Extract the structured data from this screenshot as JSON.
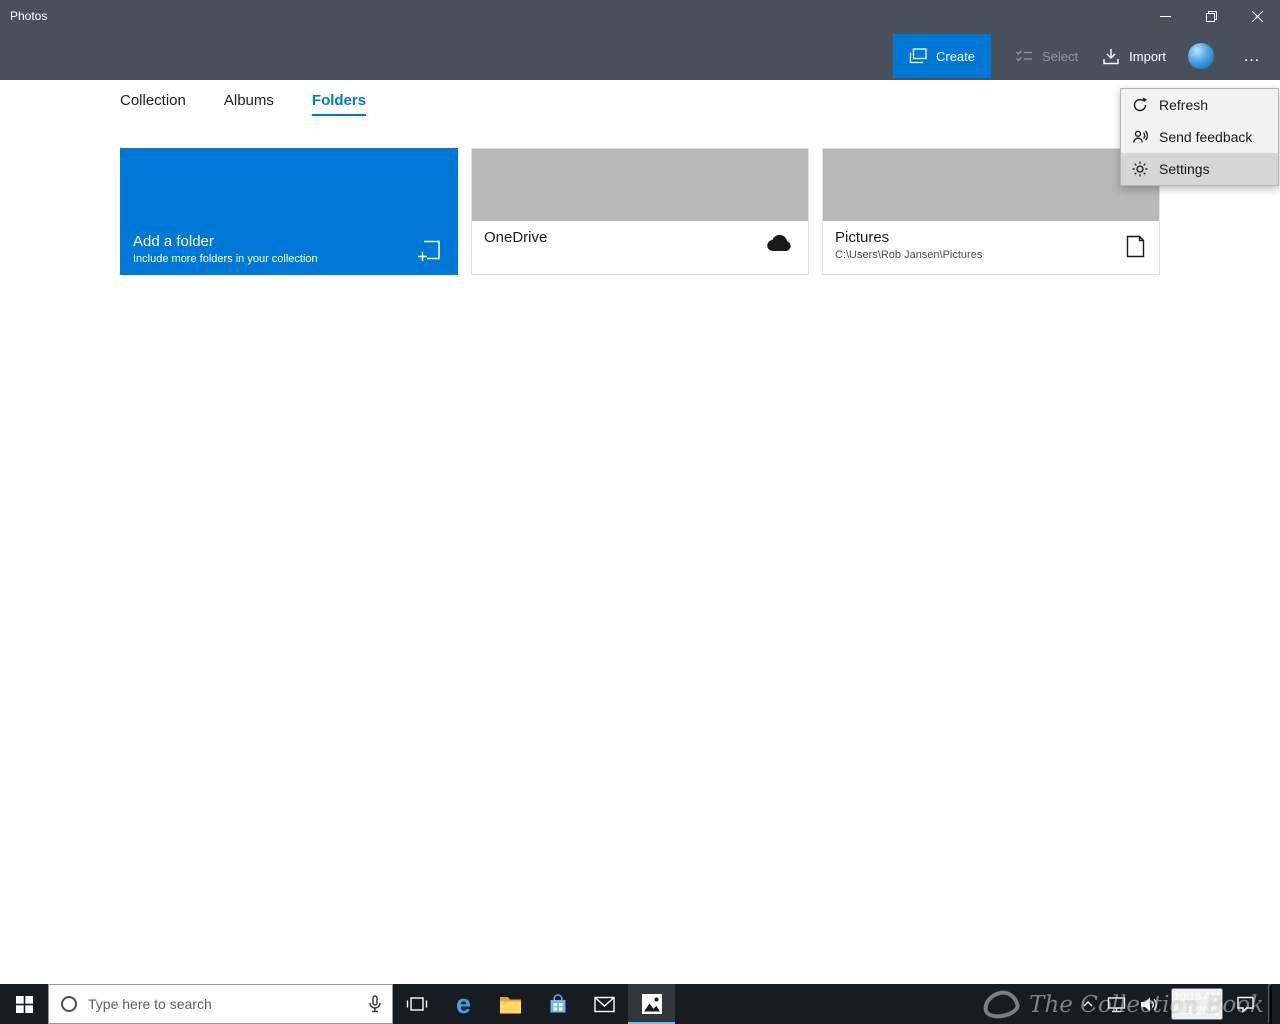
{
  "window": {
    "title": "Photos"
  },
  "toolbar": {
    "create_label": "Create",
    "select_label": "Select",
    "import_label": "Import",
    "more_label": "…"
  },
  "tabs": [
    {
      "label": "Collection"
    },
    {
      "label": "Albums"
    },
    {
      "label": "Folders"
    }
  ],
  "active_tab": "Folders",
  "menu": {
    "items": [
      {
        "label": "Refresh",
        "icon": "refresh-icon"
      },
      {
        "label": "Send feedback",
        "icon": "feedback-icon"
      },
      {
        "label": "Settings",
        "icon": "gear-icon",
        "highlighted": true
      }
    ]
  },
  "content": {
    "add_tile": {
      "title": "Add a folder",
      "subtitle": "Include more folders in your collection",
      "icon": "add-folder-icon"
    },
    "tiles": [
      {
        "title": "OneDrive",
        "path": "",
        "icon": "cloud-icon"
      },
      {
        "title": "Pictures",
        "path": "C:\\Users\\Rob Jansen\\Pictures",
        "icon": "picture-frame-icon"
      }
    ]
  },
  "taskbar": {
    "search_placeholder": "Type here to search",
    "edge_glyph": "e",
    "clock_time": "10:16 AM",
    "clock_date": "8/11/2018"
  },
  "watermark": "The Collection Book",
  "colors": {
    "accent": "#0078d7",
    "header": "#48515a",
    "taskbar": "#171c21",
    "tile_placeholder": "#b8b8b8"
  }
}
